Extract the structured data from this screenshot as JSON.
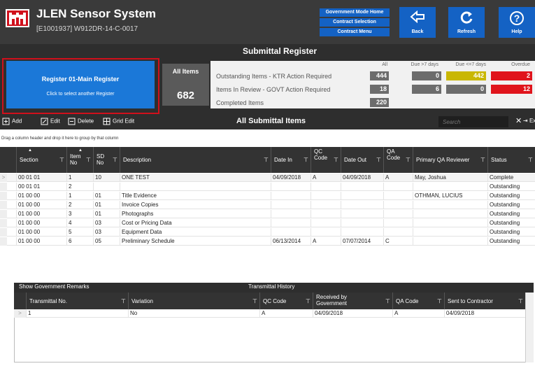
{
  "header": {
    "title": "JLEN Sensor System",
    "subtitle": "[E1001937] W912DR-14-C-0017",
    "nav_buttons": [
      "Government Mode Home",
      "Contract Selection",
      "Contract Menu"
    ],
    "tool_buttons": [
      {
        "label": "Back",
        "icon": "back-arrow-icon"
      },
      {
        "label": "Refresh",
        "icon": "refresh-icon"
      },
      {
        "label": "Help",
        "icon": "help-icon"
      }
    ]
  },
  "register": {
    "page_title": "Submittal Register",
    "selector_title": "Register 01-Main Register",
    "selector_hint": "Click to select another Register",
    "all_items_label": "All Items",
    "all_items_count": "682"
  },
  "stats": {
    "columns": [
      "All",
      "Due >7 days",
      "Due <=7 days",
      "Overdue"
    ],
    "rows": [
      {
        "label": "Outstanding Items - KTR Action Required",
        "values": [
          "444",
          "0",
          "442",
          "2"
        ]
      },
      {
        "label": "Items In Review - GOVT Action Required",
        "values": [
          "18",
          "6",
          "0",
          "12"
        ]
      },
      {
        "label": "Completed Items",
        "values": [
          "220"
        ]
      }
    ],
    "colors": {
      "gray": "#6c6c6c",
      "yellow": "#c9b704",
      "red": "#e0141c"
    }
  },
  "toolbar": {
    "add": "Add",
    "edit": "Edit",
    "delete": "Delete",
    "grid_edit": "Grid Edit",
    "grid_title": "All Submittal Items",
    "search_placeholder": "Search",
    "export": "Expo"
  },
  "group_hint": "Drag a column header and drop it here to group by that column",
  "grid": {
    "columns": [
      "Section",
      "Item No",
      "SD No",
      "Description",
      "Date In",
      "QC Code",
      "Date Out",
      "QA Code",
      "Primary QA Reviewer",
      "Status"
    ],
    "rows": [
      [
        "00 01 01",
        "1",
        "10",
        "ONE TEST",
        "04/09/2018",
        "A",
        "04/09/2018",
        "A",
        "May, Joshua",
        "Complete"
      ],
      [
        "00 01 01",
        "2",
        "",
        "",
        "",
        "",
        "",
        "",
        "",
        "Outstanding"
      ],
      [
        "01 00 00",
        "1",
        "01",
        "Title Evidence",
        "",
        "",
        "",
        "",
        "OTHMAN, LUCIUS",
        "Outstanding"
      ],
      [
        "01 00 00",
        "2",
        "01",
        "Invoice Copies",
        "",
        "",
        "",
        "",
        "",
        "Outstanding"
      ],
      [
        "01 00 00",
        "3",
        "01",
        "Photographs",
        "",
        "",
        "",
        "",
        "",
        "Outstanding"
      ],
      [
        "01 00 00",
        "4",
        "03",
        "Cost or Pricing Data",
        "",
        "",
        "",
        "",
        "",
        "Outstanding"
      ],
      [
        "01 00 00",
        "5",
        "03",
        "Equipment Data",
        "",
        "",
        "",
        "",
        "",
        "Outstanding"
      ],
      [
        "01 00 00",
        "6",
        "05",
        "Preliminary Schedule",
        "06/13/2014",
        "A",
        "07/07/2014",
        "C",
        "",
        "Outstanding"
      ]
    ]
  },
  "lower": {
    "remarks_label": "Show Government Remarks",
    "history_label": "Transmittal History",
    "columns": [
      "Transmittal No.",
      "Variation",
      "QC Code",
      "Received by Government",
      "QA Code",
      "Sent to Contractor"
    ],
    "rows": [
      [
        "1",
        "No",
        "A",
        "04/09/2018",
        "A",
        "04/09/2018"
      ]
    ]
  }
}
